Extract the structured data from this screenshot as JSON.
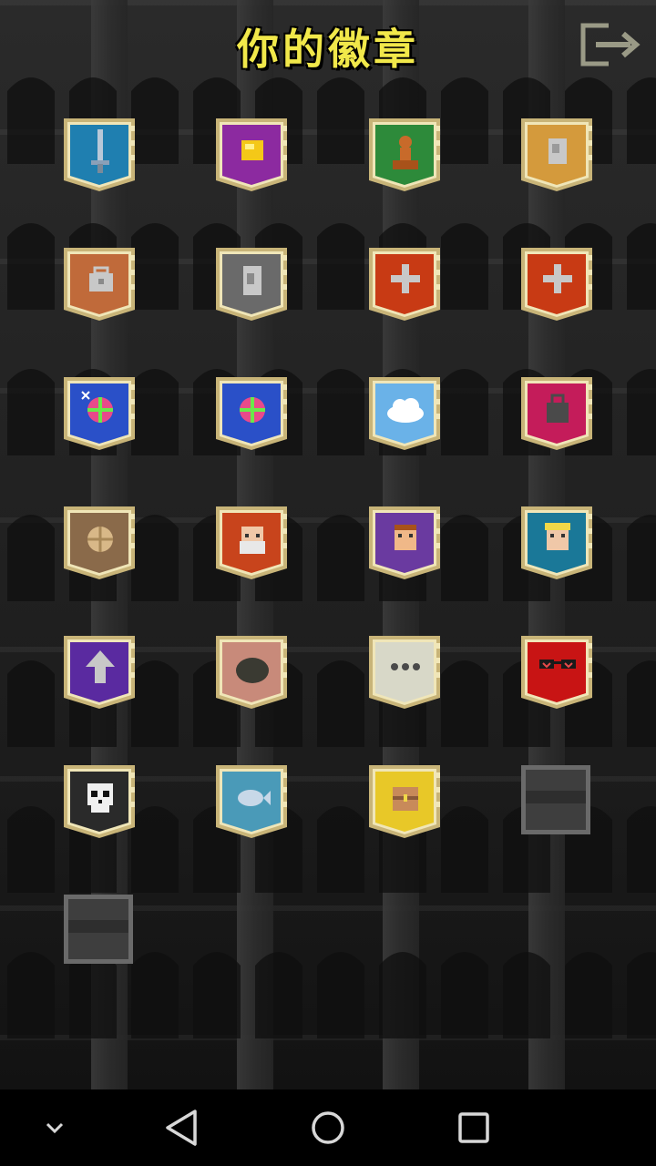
{
  "header": {
    "title": "你的徽章",
    "exit_icon": "exit-icon"
  },
  "badges": [
    {
      "name": "badge-sword-icon",
      "bg": "#1f7fb0",
      "shape": "banner",
      "locked": false
    },
    {
      "name": "badge-gold-icon",
      "bg": "#8c2aa0",
      "shape": "banner",
      "locked": false
    },
    {
      "name": "badge-pawn-icon",
      "bg": "#2d8a3a",
      "shape": "banner",
      "locked": false
    },
    {
      "name": "badge-stone-icon",
      "bg": "#d49a3c",
      "shape": "banner",
      "locked": false
    },
    {
      "name": "badge-bag-icon",
      "bg": "#c06a3a",
      "shape": "banner",
      "locked": false
    },
    {
      "name": "badge-keycard-icon",
      "bg": "#6a6a6a",
      "shape": "banner",
      "locked": false
    },
    {
      "name": "badge-cross-icon",
      "bg": "#c83a14",
      "shape": "banner",
      "locked": false
    },
    {
      "name": "badge-cross-icon",
      "bg": "#c83a14",
      "shape": "banner",
      "locked": false
    },
    {
      "name": "badge-gem-sparkle-icon",
      "bg": "#2a50c8",
      "shape": "banner",
      "locked": false
    },
    {
      "name": "badge-gem-icon",
      "bg": "#2a50c8",
      "shape": "banner",
      "locked": false
    },
    {
      "name": "badge-cloud-icon",
      "bg": "#6ab2e8",
      "shape": "banner",
      "locked": false
    },
    {
      "name": "badge-weight-icon",
      "bg": "#c41c5a",
      "shape": "banner",
      "locked": false
    },
    {
      "name": "badge-compass-icon",
      "bg": "#8a6a4a",
      "shape": "banner",
      "locked": false
    },
    {
      "name": "badge-old-man-icon",
      "bg": "#c8441c",
      "shape": "banner",
      "locked": false
    },
    {
      "name": "badge-warrior-face-icon",
      "bg": "#6a3aa0",
      "shape": "banner",
      "locked": false
    },
    {
      "name": "badge-blonde-face-icon",
      "bg": "#1a7898",
      "shape": "banner",
      "locked": false
    },
    {
      "name": "badge-arrow-up-icon",
      "bg": "#5a2aa0",
      "shape": "banner",
      "locked": false
    },
    {
      "name": "badge-pot-icon",
      "bg": "#c88a7a",
      "shape": "banner",
      "locked": false
    },
    {
      "name": "badge-dots-icon",
      "bg": "#d8d8c8",
      "shape": "banner",
      "locked": false
    },
    {
      "name": "badge-glasses-icon",
      "bg": "#c81414",
      "shape": "banner",
      "locked": false
    },
    {
      "name": "badge-skull-icon",
      "bg": "#2a2a2a",
      "shape": "banner",
      "locked": false
    },
    {
      "name": "badge-fish-icon",
      "bg": "#4a9ab8",
      "shape": "banner",
      "locked": false
    },
    {
      "name": "badge-chest-icon",
      "bg": "#e8c828",
      "shape": "banner",
      "locked": false
    },
    {
      "name": "badge-locked-slot",
      "bg": "#3a3a3a",
      "shape": "slot",
      "locked": true
    },
    {
      "name": "badge-locked-slot",
      "bg": "#3a3a3a",
      "shape": "slot",
      "locked": true
    }
  ],
  "navbar": {
    "items": [
      "chevron-down-icon",
      "back-triangle-icon",
      "home-circle-icon",
      "recents-square-icon"
    ]
  }
}
